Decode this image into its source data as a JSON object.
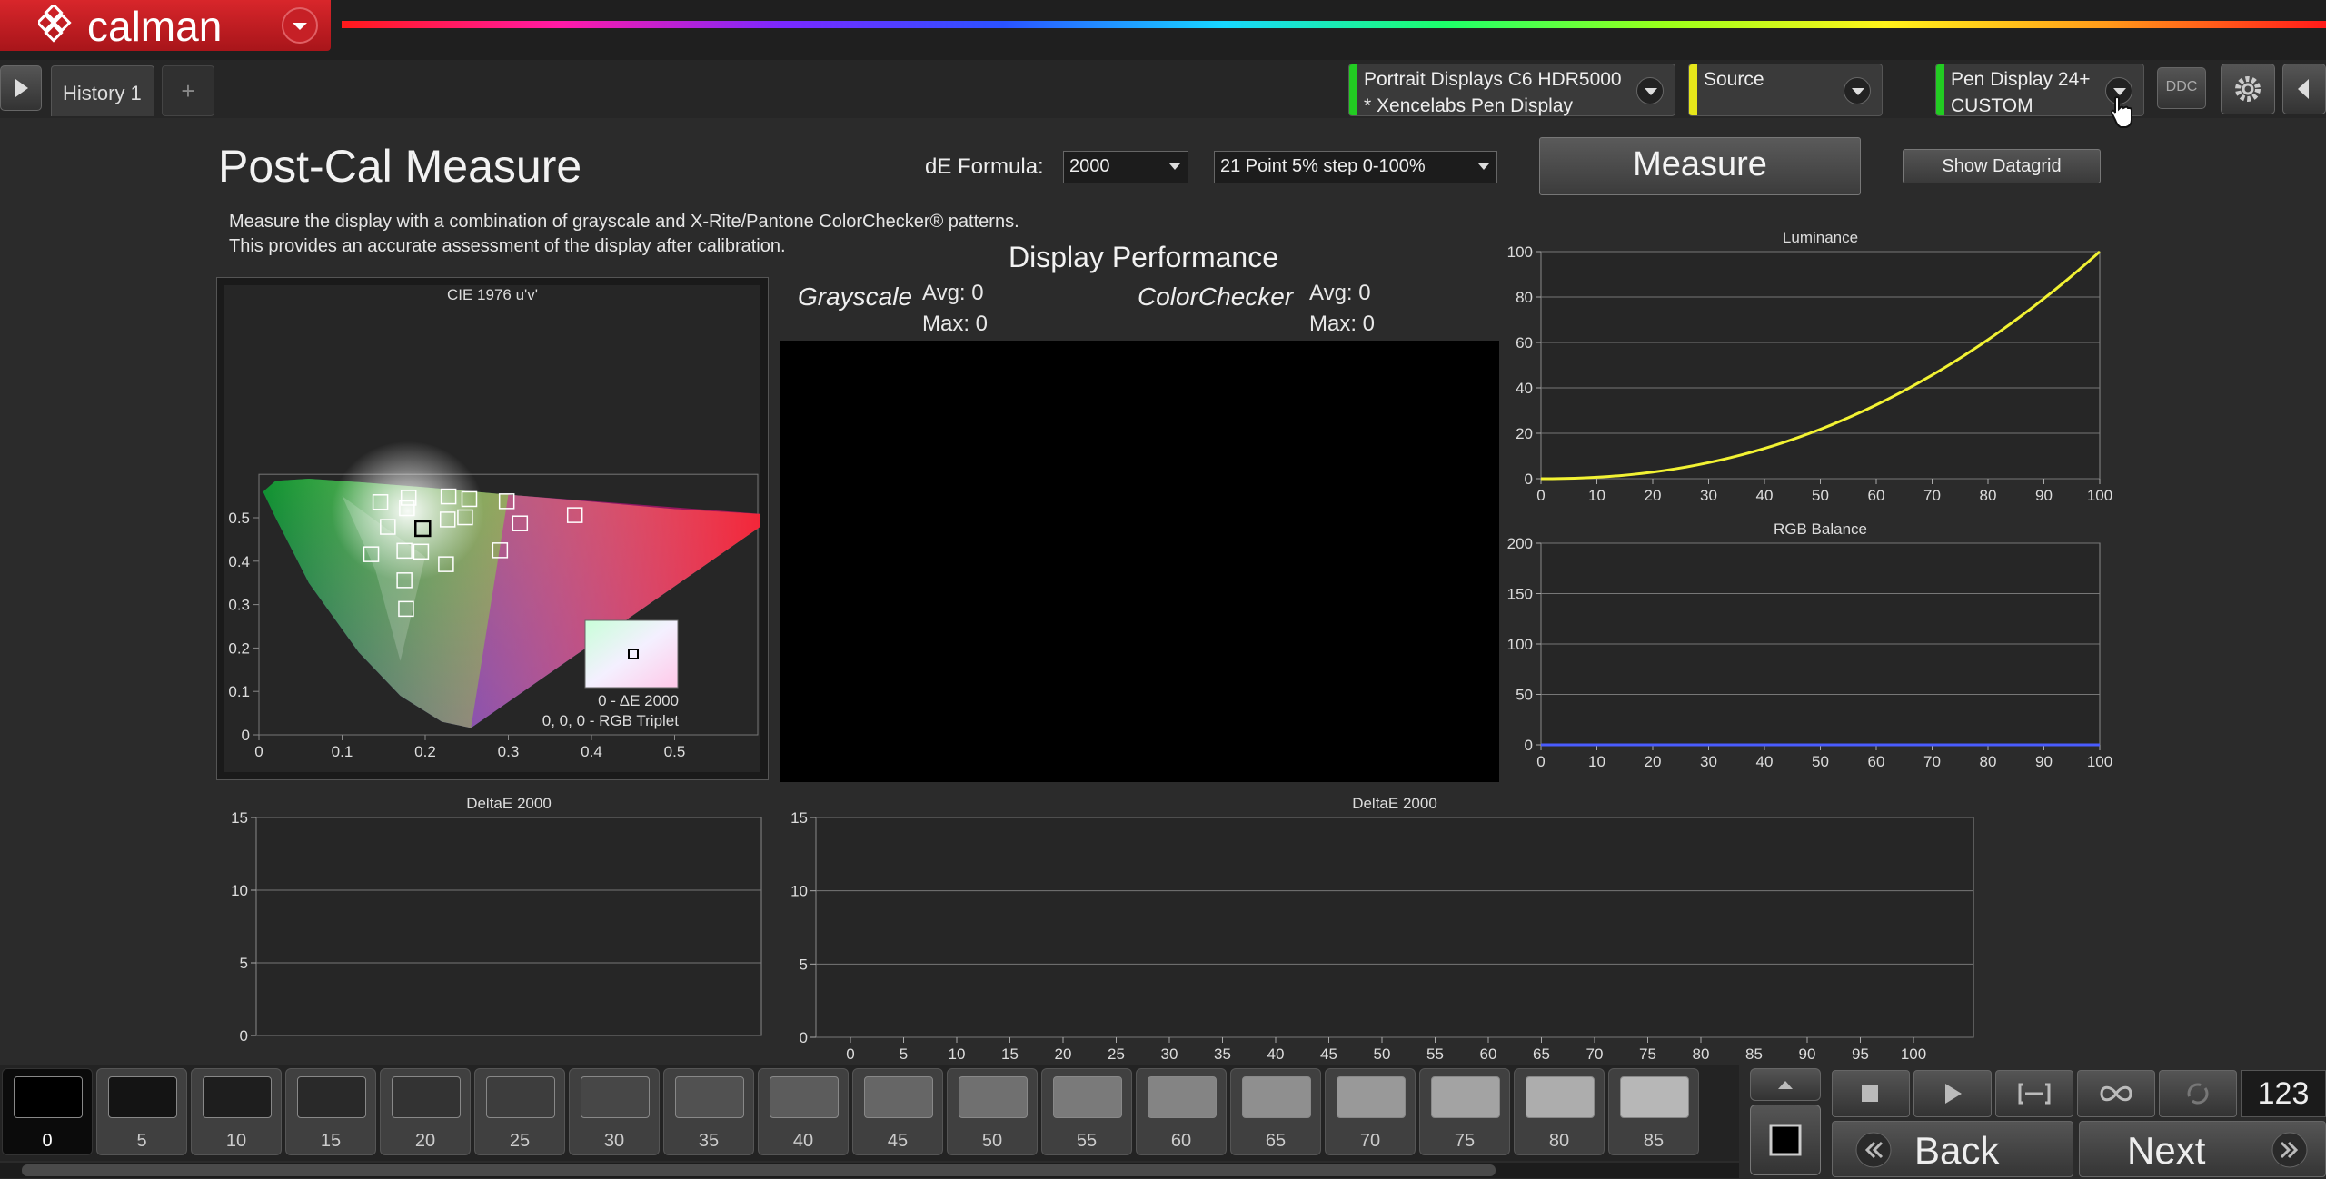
{
  "app": {
    "name": "calman"
  },
  "tabs": [
    {
      "label": "History 1"
    }
  ],
  "devices": {
    "meter": {
      "line1": "Portrait Displays C6 HDR5000",
      "line2": "* Xencelabs Pen Display",
      "led": "#22cc22"
    },
    "source": {
      "line1": "Source",
      "line2": "",
      "led": "#e6e61a"
    },
    "display": {
      "line1": "Pen Display 24+",
      "line2": "CUSTOM",
      "led": "#22cc22"
    },
    "ddc_label": "DDC"
  },
  "page": {
    "title": "Post-Cal Measure",
    "desc1": "Measure the display with a combination of grayscale and X-Rite/Pantone ColorChecker® patterns.",
    "desc2": "This provides an accurate assessment of the display after calibration."
  },
  "controls": {
    "de_label": "dE Formula:",
    "de_value": "2000",
    "step_value": "21 Point 5% step 0-100%",
    "measure_label": "Measure",
    "datagrid_label": "Show Datagrid"
  },
  "cie": {
    "title": "CIE 1976 u'v'",
    "x_ticks": [
      "0",
      "0.1",
      "0.2",
      "0.3",
      "0.4",
      "0.5"
    ],
    "y_ticks": [
      "0",
      "0.1",
      "0.2",
      "0.3",
      "0.4",
      "0.5"
    ],
    "de_text": "0 - ΔE 2000",
    "rgb_text": "0, 0, 0 - RGB Triplet",
    "targets": [
      [
        0.146,
        0.536
      ],
      [
        0.18,
        0.546
      ],
      [
        0.228,
        0.549
      ],
      [
        0.253,
        0.543
      ],
      [
        0.298,
        0.538
      ],
      [
        0.178,
        0.522
      ],
      [
        0.227,
        0.496
      ],
      [
        0.248,
        0.501
      ],
      [
        0.155,
        0.479
      ],
      [
        0.314,
        0.487
      ],
      [
        0.38,
        0.506
      ],
      [
        0.135,
        0.416
      ],
      [
        0.175,
        0.424
      ],
      [
        0.195,
        0.422
      ],
      [
        0.29,
        0.425
      ],
      [
        0.225,
        0.393
      ],
      [
        0.175,
        0.356
      ],
      [
        0.177,
        0.29
      ]
    ],
    "current": [
      0.197,
      0.475
    ]
  },
  "performance": {
    "title": "Display Performance",
    "grayscale_label": "Grayscale",
    "grayscale_avg": "Avg: 0",
    "grayscale_max": "Max: 0",
    "colorchecker_label": "ColorChecker",
    "colorchecker_avg": "Avg: 0",
    "colorchecker_max": "Max: 0"
  },
  "chart_data": [
    {
      "type": "line",
      "title": "Luminance",
      "x_ticks": [
        0,
        10,
        20,
        30,
        40,
        50,
        60,
        70,
        80,
        90,
        100
      ],
      "y_ticks": [
        0,
        20,
        40,
        60,
        80,
        100
      ],
      "xlim": [
        0,
        100
      ],
      "ylim": [
        0,
        100
      ],
      "series": [
        {
          "color": "#f2f233",
          "gamma": 2.2
        }
      ]
    },
    {
      "type": "line",
      "title": "RGB Balance",
      "x_ticks": [
        0,
        10,
        20,
        30,
        40,
        50,
        60,
        70,
        80,
        90,
        100
      ],
      "y_ticks": [
        0,
        50,
        100,
        150,
        200
      ],
      "xlim": [
        0,
        100
      ],
      "ylim": [
        0,
        200
      ],
      "series": [
        {
          "color": "#4a5cff",
          "values": [
            0,
            0,
            0,
            0,
            0,
            0,
            0,
            0,
            0,
            0,
            0
          ]
        }
      ]
    },
    {
      "type": "bar",
      "title": "DeltaE 2000",
      "y_ticks": [
        0,
        5,
        10,
        15
      ],
      "ylim": [
        0,
        15
      ]
    },
    {
      "type": "bar",
      "title": "DeltaE 2000",
      "x_ticks": [
        0,
        5,
        10,
        15,
        20,
        25,
        30,
        35,
        40,
        45,
        50,
        55,
        60,
        65,
        70,
        75,
        80,
        85,
        90,
        95,
        100
      ],
      "y_ticks": [
        0,
        5,
        10,
        15
      ],
      "ylim": [
        0,
        15
      ]
    }
  ],
  "patches": [
    {
      "label": "0",
      "gray": 0
    },
    {
      "label": "5",
      "gray": 5
    },
    {
      "label": "10",
      "gray": 10
    },
    {
      "label": "15",
      "gray": 15
    },
    {
      "label": "20",
      "gray": 20
    },
    {
      "label": "25",
      "gray": 25
    },
    {
      "label": "30",
      "gray": 30
    },
    {
      "label": "35",
      "gray": 35
    },
    {
      "label": "40",
      "gray": 40
    },
    {
      "label": "45",
      "gray": 45
    },
    {
      "label": "50",
      "gray": 50
    },
    {
      "label": "55",
      "gray": 55
    },
    {
      "label": "60",
      "gray": 60
    },
    {
      "label": "65",
      "gray": 65
    },
    {
      "label": "70",
      "gray": 70
    },
    {
      "label": "75",
      "gray": 75
    },
    {
      "label": "80",
      "gray": 80
    },
    {
      "label": "85",
      "gray": 85
    }
  ],
  "transport": {
    "counter": "123",
    "back_label": "Back",
    "next_label": "Next"
  }
}
